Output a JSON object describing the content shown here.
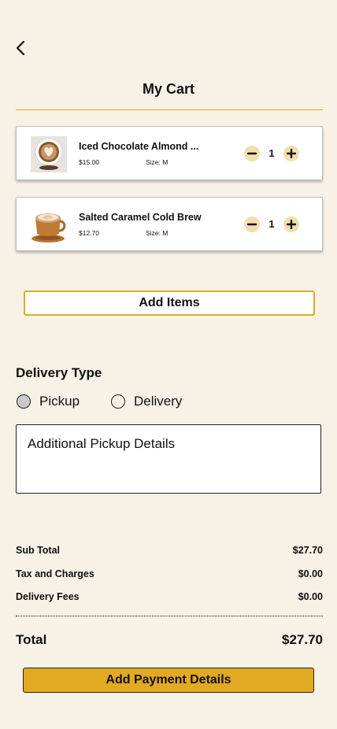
{
  "header": {
    "title": "My Cart",
    "back_icon": "chevron-left-icon"
  },
  "cart": {
    "items": [
      {
        "name": "Iced Chocolate Almond ...",
        "price": "$15.00",
        "size": "Size: M",
        "quantity": "1"
      },
      {
        "name": "Salted Caramel Cold Brew",
        "price": "$12.70",
        "size": "Size: M",
        "quantity": "1"
      }
    ],
    "add_items_label": "Add Items"
  },
  "delivery": {
    "title": "Delivery Type",
    "options": [
      {
        "label": "Pickup",
        "selected": true
      },
      {
        "label": "Delivery",
        "selected": false
      }
    ],
    "details_placeholder": "Additional Pickup Details"
  },
  "summary": {
    "sub_total_label": "Sub Total",
    "sub_total_value": "$27.70",
    "tax_label": "Tax and Charges",
    "tax_value": "$0.00",
    "delivery_fee_label": "Delivery Fees",
    "delivery_fee_value": "$0.00",
    "total_label": "Total",
    "total_value": "$27.70"
  },
  "payment": {
    "button_label": "Add Payment Details"
  },
  "colors": {
    "background": "#f8f1e6",
    "accent": "#e2aa22",
    "qty_button": "#f2dfb0"
  }
}
